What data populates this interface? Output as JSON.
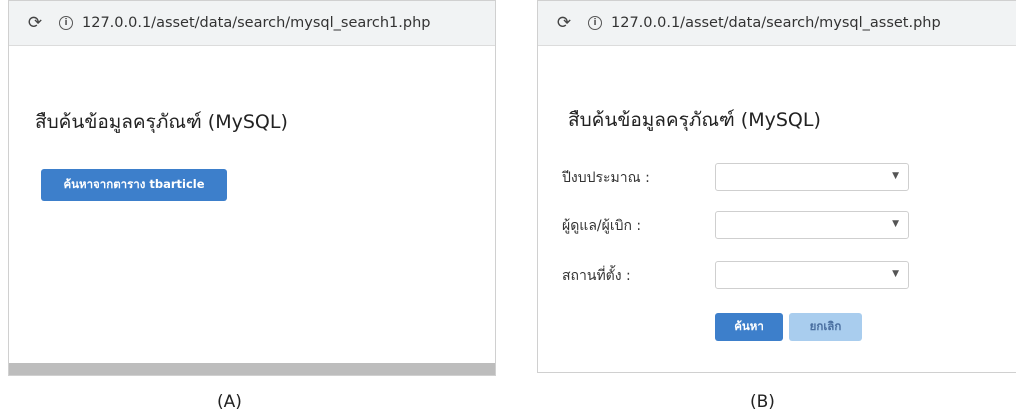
{
  "panel_a": {
    "url": "127.0.0.1/asset/data/search/mysql_search1.php",
    "title": "สืบค้นข้อมูลครุภัณฑ์ (MySQL)",
    "search_button_label": "ค้นหาจากตาราง tbarticle"
  },
  "panel_b": {
    "url": "127.0.0.1/asset/data/search/mysql_asset.php",
    "title": "สืบค้นข้อมูลครุภัณฑ์ (MySQL)",
    "fields": [
      {
        "label": "ปีงบประมาณ :",
        "value": ""
      },
      {
        "label": "ผู้ดูแล/ผู้เบิก :",
        "value": ""
      },
      {
        "label": "สถานที่ตั้ง :",
        "value": ""
      }
    ],
    "search_label": "ค้นหา",
    "cancel_label": "ยกเลิก"
  },
  "captions": {
    "a": "(A)",
    "b": "(B)"
  },
  "icons": {
    "reload": "reload-icon",
    "info": "info-icon",
    "dropdown": "chevron-down-icon"
  },
  "colors": {
    "primary_button": "#3d7fcb",
    "secondary_button": "#a9cdee"
  }
}
